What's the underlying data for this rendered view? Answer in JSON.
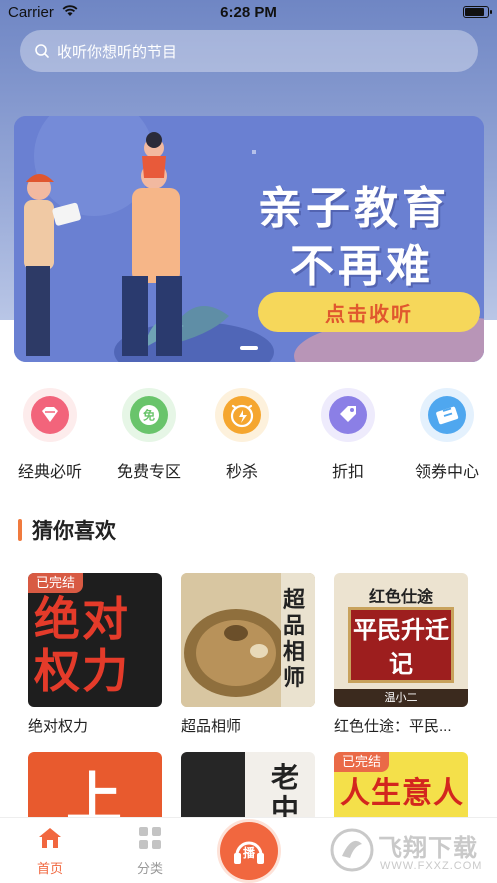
{
  "status": {
    "carrier": "Carrier",
    "time": "6:28 PM"
  },
  "search": {
    "placeholder": "收听你想听的节目"
  },
  "banner": {
    "title_line1": "亲子教育",
    "title_line2": "不再难",
    "cta": "点击收听"
  },
  "quick_links": [
    {
      "label": "经典必听",
      "icon": "diamond-icon",
      "color": "#f2647b"
    },
    {
      "label": "免费专区",
      "icon": "free-icon",
      "color": "#69c46b"
    },
    {
      "label": "秒杀",
      "icon": "alarm-clock-icon",
      "color": "#f5a62f"
    },
    {
      "label": "折扣",
      "icon": "tag-icon",
      "color": "#8b7fe6"
    },
    {
      "label": "领券中心",
      "icon": "coupon-icon",
      "color": "#4fa7ef"
    }
  ],
  "recommend": {
    "title": "猜你喜欢",
    "books": [
      {
        "title": "绝对权力",
        "badge": "已完结",
        "cover_text": "绝对权力"
      },
      {
        "title": "超品相师",
        "badge": "",
        "cover_text": "超品相师"
      },
      {
        "title": "红色仕途：平民...",
        "badge": "",
        "cover_text_top": "红色仕途",
        "cover_text_main": "平民升迁记",
        "cover_author": "温小二"
      },
      {
        "title": "",
        "badge": "",
        "cover_text": "上"
      },
      {
        "title": "",
        "badge": "",
        "cover_text": "老中医"
      },
      {
        "title": "",
        "badge": "已完结",
        "cover_text": "人生意人"
      }
    ]
  },
  "tabbar": {
    "home": "首页",
    "category": "分类",
    "play": "播"
  },
  "watermark": {
    "text": "飞翔下载",
    "url": "WWW.FXXZ.COM"
  },
  "colors": {
    "accent": "#f1673f",
    "header_bg": "#7f93cc"
  }
}
